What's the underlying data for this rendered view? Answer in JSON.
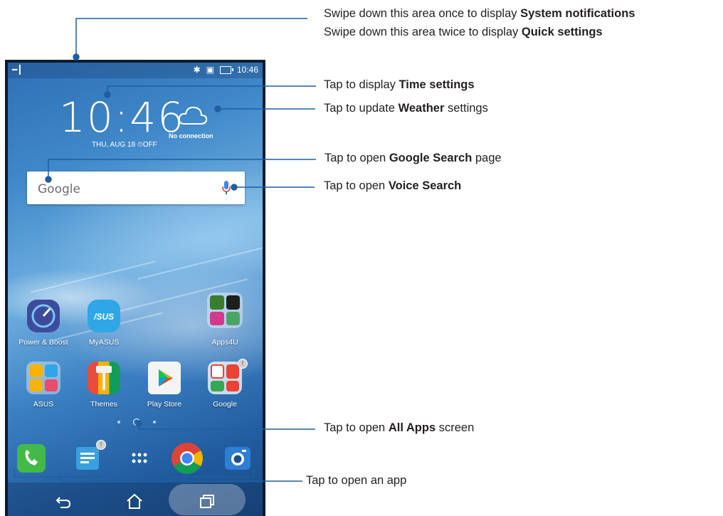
{
  "status_bar": {
    "time": "10:46",
    "left_icon": "notification-icon",
    "right_icons": [
      "bluetooth-icon",
      "vibrate-icon",
      "battery-icon"
    ]
  },
  "clock": {
    "time": "10:46",
    "date": "THU, AUG 18",
    "alarm": "OFF"
  },
  "weather": {
    "status": "No connection"
  },
  "search": {
    "logo_text": "Google"
  },
  "apps_row1": [
    {
      "label": "Power & Boost",
      "icon": "power-boost-icon"
    },
    {
      "label": "MyASUS",
      "icon": "myasus-icon"
    },
    {
      "label": "Apps4U",
      "icon": "apps4u-folder-icon"
    }
  ],
  "apps_row2": [
    {
      "label": "ASUS",
      "icon": "asus-folder-icon"
    },
    {
      "label": "Themes",
      "icon": "themes-icon"
    },
    {
      "label": "Play Store",
      "icon": "play-store-icon"
    },
    {
      "label": "Google",
      "icon": "google-folder-icon"
    }
  ],
  "dock": [
    "phone-icon",
    "messages-icon",
    "all-apps-icon",
    "chrome-icon",
    "camera-icon"
  ],
  "navbar": [
    "back-icon",
    "home-icon",
    "recents-icon"
  ],
  "callouts": {
    "system_notifications": {
      "prefix": "Swipe down this area once to display ",
      "bold": "System notifications"
    },
    "quick_settings": {
      "prefix": "Swipe down this area twice to display ",
      "bold": "Quick settings"
    },
    "time_settings": {
      "prefix": "Tap to display ",
      "bold": "Time settings",
      "suffix": ""
    },
    "weather": {
      "prefix": "Tap to update ",
      "bold": "Weather",
      "suffix": " settings"
    },
    "google_search": {
      "prefix": "Tap to open ",
      "bold": "Google Search",
      "suffix": " page"
    },
    "voice_search": {
      "prefix": "Tap to open ",
      "bold": "Voice Search",
      "suffix": ""
    },
    "all_apps": {
      "prefix": "Tap to open ",
      "bold": "All Apps",
      "suffix": " screen"
    },
    "open_app": {
      "text": "Tap to open an app"
    }
  },
  "colors": {
    "callout_line": "#1f5f9e",
    "text": "#231f20"
  }
}
